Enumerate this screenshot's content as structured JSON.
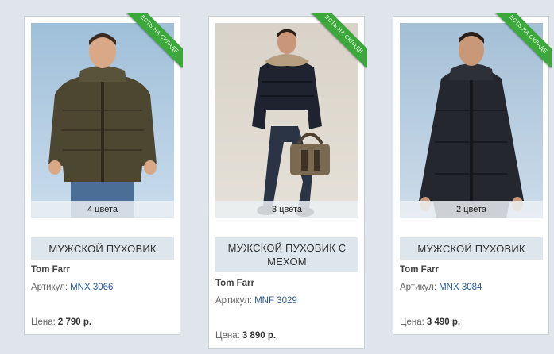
{
  "products": [
    {
      "ribbon": "ЕСТЬ НА СКЛАДЕ",
      "colors": "4 цвета",
      "name": "МУЖСКОЙ ПУХОВИК",
      "brand": "Tom Farr",
      "sku_label": "Артикул:",
      "sku": "MNX 3066",
      "price_label": "Цена:",
      "price": "2 790 р."
    },
    {
      "ribbon": "ЕСТЬ НА СКЛАДЕ",
      "colors": "3 цвета",
      "name": "МУЖСКОЙ ПУХОВИК С МЕХОМ",
      "brand": "Tom Farr",
      "sku_label": "Артикул:",
      "sku": "MNF 3029",
      "price_label": "Цена:",
      "price": "3 890 р."
    },
    {
      "ribbon": "ЕСТЬ НА СКЛАДЕ",
      "colors": "2 цвета",
      "name": "МУЖСКОЙ ПУХОВИК",
      "brand": "Tom Farr",
      "sku_label": "Артикул:",
      "sku": "MNX 3084",
      "price_label": "Цена:",
      "price": "3 490 р."
    }
  ],
  "colors": {
    "ribbon": "#3ca83c",
    "link": "#2a5c9a",
    "name_box": "#dde6ec"
  }
}
